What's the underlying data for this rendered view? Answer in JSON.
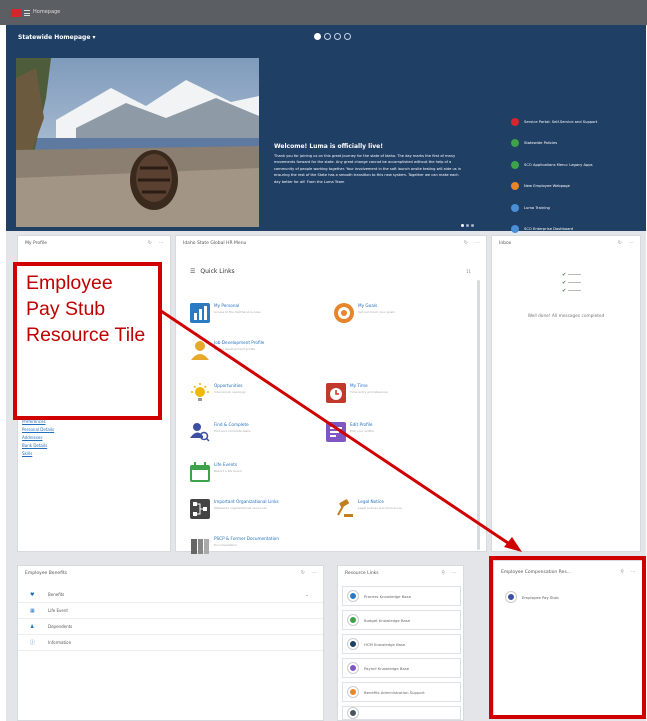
{
  "topbar": {
    "app_title": "Homepage"
  },
  "hero": {
    "title": "Statewide Homepage ▾",
    "welcome_heading": "Welcome! Luma is officially live!",
    "welcome_body": "Thank you for joining us on this great journey for the state of Idaho. The day marks the first of many movements forward for the state. Any great change cannot be accomplished without the help of a community of people working together. Your involvement in the soft launch onsite testing will aide us in ensuring the rest of the State has a smooth transition to this new system. Together we can make each day better for all! From the Luma Team",
    "links": [
      {
        "label": "Service Portal: Self-Service and Support",
        "color": "#d6262d"
      },
      {
        "label": "Statewide Policies",
        "color": "#3da24a"
      },
      {
        "label": "SCO Applications Menu: Legacy Apps",
        "color": "#3da24a"
      },
      {
        "label": "New Employee Webpage",
        "color": "#e6852b"
      },
      {
        "label": "Luma Training",
        "color": "#4a8fd6"
      },
      {
        "label": "SCO Enterprise Dashboard",
        "color": "#4a8fd6"
      }
    ]
  },
  "profile": {
    "title": "My Profile",
    "links": [
      "Preferences",
      "Personal Details",
      "Addresses",
      "Bank Details",
      "Skills"
    ]
  },
  "quick_links": {
    "panel_title": "Idaho State Global HR Menu",
    "title": "Quick Links",
    "count": "11",
    "items": [
      {
        "title": "My Personal",
        "desc": "Access to the Self-Service Area",
        "color": "#2a7bc4"
      },
      {
        "title": "My Goals",
        "desc": "Set and track your goals",
        "color": "#e6852b"
      },
      {
        "title": "Job Development Profile",
        "desc": "Career development profile",
        "color": "#e6a92b"
      },
      {
        "title": "Opportunities",
        "desc": "Internal job openings",
        "color": "#f0b800"
      },
      {
        "title": "My Time",
        "desc": "Time entry and absences",
        "color": "#c0392b"
      },
      {
        "title": "Find & Complete",
        "desc": "Find and complete tasks",
        "color": "#3c4fa3"
      },
      {
        "title": "Edit Profile",
        "desc": "Edit your profile",
        "color": "#7e57c2"
      },
      {
        "title": "Life Events",
        "desc": "Report a life event",
        "color": "#3da24a"
      },
      {
        "title": "Important Organizational Links",
        "desc": "Statewide organizational resources",
        "color": "#444444"
      },
      {
        "title": "Legal Notice",
        "desc": "Legal notices and disclosures",
        "color": "#c17f1e"
      },
      {
        "title": "PSCP & Former Documentation",
        "desc": "Documentation",
        "color": "#666666"
      }
    ]
  },
  "inbox": {
    "title": "Inbox",
    "empty_text": "Well done! All messages completed"
  },
  "benefits": {
    "title": "Employee Benefits",
    "rows": [
      {
        "icon": "♥",
        "label": "Benefits"
      },
      {
        "icon": "▦",
        "label": "Life Event"
      },
      {
        "icon": "♟",
        "label": "Dependents"
      },
      {
        "icon": "ⓘ",
        "label": "Information"
      }
    ]
  },
  "resource_links": {
    "title": "Resource Links",
    "items": [
      {
        "label": "Process Knowledge Base",
        "color": "#2a7bc4"
      },
      {
        "label": "Budget Knowledge Base",
        "color": "#3da24a"
      },
      {
        "label": "HCM Knowledge Base",
        "color": "#203f65"
      },
      {
        "label": "Payroll Knowledge Base",
        "color": "#7e57c2"
      },
      {
        "label": "Benefits Administration Support",
        "color": "#e6852b"
      },
      {
        "label": "",
        "color": "#4a5560"
      }
    ]
  },
  "compensation": {
    "title": "Employee Compensation Res...",
    "item": "Employee Pay Stub"
  },
  "callout": {
    "text": "Employee Pay Stub Resource Tile"
  },
  "accent_red": "#d00000",
  "hero_bg": "#203f65"
}
